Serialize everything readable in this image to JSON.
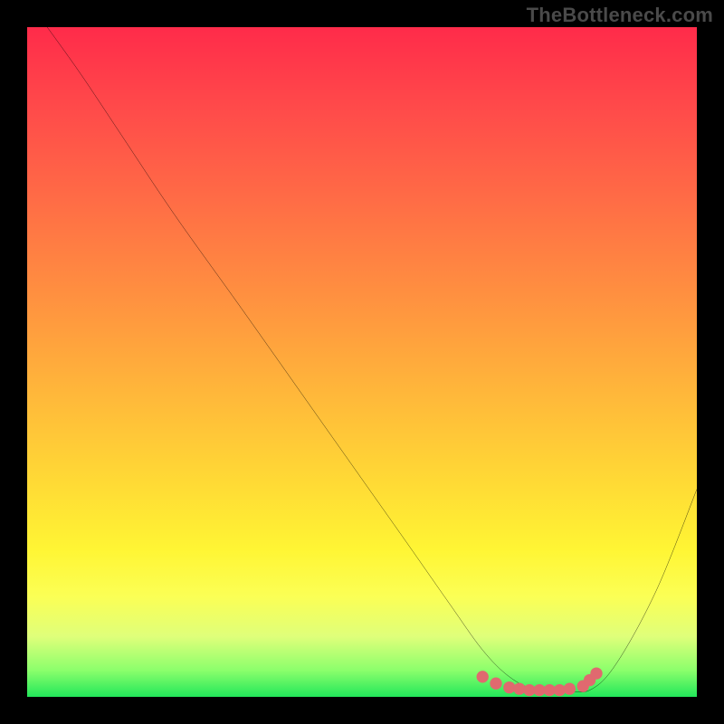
{
  "watermark": "TheBottleneck.com",
  "chart_data": {
    "type": "line",
    "title": "",
    "xlabel": "",
    "ylabel": "",
    "xlim": [
      0,
      100
    ],
    "ylim": [
      0,
      100
    ],
    "grid": false,
    "legend": false,
    "gradient_stops": [
      {
        "pct": 0,
        "color": "#ff2b4a"
      },
      {
        "pct": 12,
        "color": "#ff4a4a"
      },
      {
        "pct": 25,
        "color": "#ff6a46"
      },
      {
        "pct": 40,
        "color": "#ff9040"
      },
      {
        "pct": 55,
        "color": "#ffb83a"
      },
      {
        "pct": 68,
        "color": "#ffda35"
      },
      {
        "pct": 78,
        "color": "#fff534"
      },
      {
        "pct": 85,
        "color": "#fbff55"
      },
      {
        "pct": 91,
        "color": "#dfff7a"
      },
      {
        "pct": 96,
        "color": "#8cff6c"
      },
      {
        "pct": 100,
        "color": "#22e75a"
      }
    ],
    "series": [
      {
        "name": "bottleneck-curve",
        "stroke": "#000000",
        "x": [
          3,
          8,
          14,
          22,
          32,
          44,
          56,
          63,
          68,
          72,
          76,
          80,
          84,
          88,
          94,
          100
        ],
        "y": [
          100,
          93,
          84,
          72,
          58,
          41,
          24,
          14,
          7,
          3,
          1,
          1,
          1,
          5,
          16,
          31
        ]
      }
    ],
    "dots": {
      "name": "plateau-dots",
      "color": "#e0696f",
      "radius_pct": 0.9,
      "points": [
        {
          "x": 68,
          "y": 3.0
        },
        {
          "x": 70,
          "y": 2.0
        },
        {
          "x": 72,
          "y": 1.4
        },
        {
          "x": 73.5,
          "y": 1.2
        },
        {
          "x": 75,
          "y": 1.0
        },
        {
          "x": 76.5,
          "y": 1.0
        },
        {
          "x": 78,
          "y": 1.0
        },
        {
          "x": 79.5,
          "y": 1.0
        },
        {
          "x": 81,
          "y": 1.2
        },
        {
          "x": 83,
          "y": 1.6
        },
        {
          "x": 84,
          "y": 2.5
        },
        {
          "x": 85,
          "y": 3.5
        }
      ]
    }
  }
}
